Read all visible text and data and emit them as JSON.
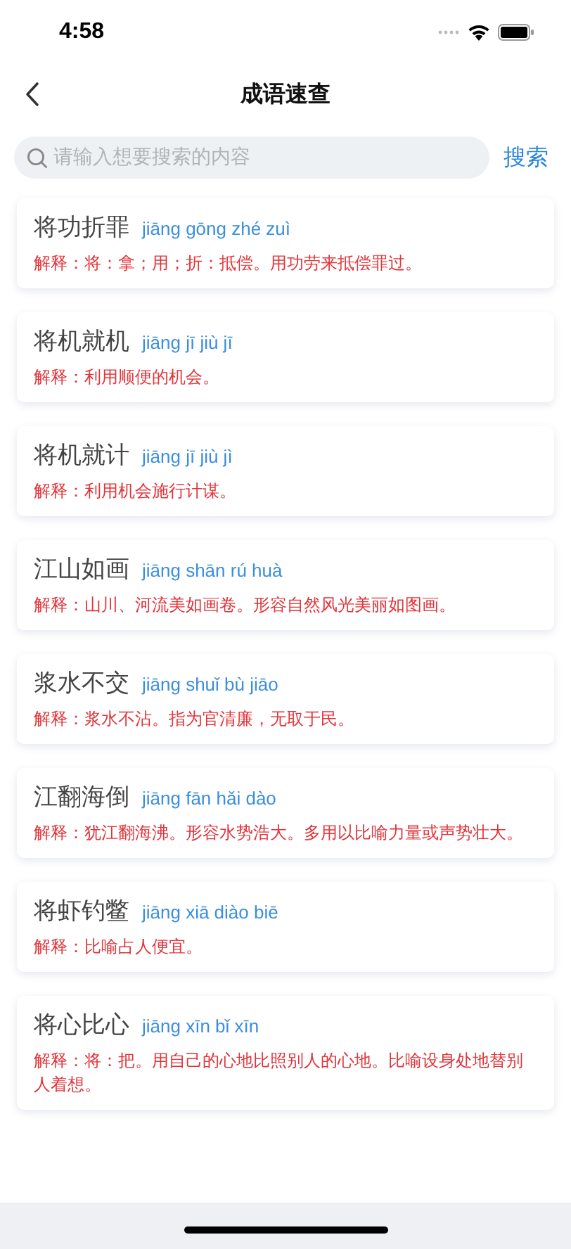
{
  "status_bar": {
    "time": "4:58"
  },
  "nav": {
    "title": "成语速查"
  },
  "search": {
    "placeholder": "请输入想要搜索的内容",
    "button": "搜索"
  },
  "idioms": [
    {
      "word": "将功折罪",
      "pinyin": "jiāng gōng zhé zuì",
      "explanation": "解释：将：拿；用；折：抵偿。用功劳来抵偿罪过。"
    },
    {
      "word": "将机就机",
      "pinyin": "jiāng jī jiù jī",
      "explanation": "解释：利用顺便的机会。"
    },
    {
      "word": "将机就计",
      "pinyin": "jiāng jī jiù jì",
      "explanation": "解释：利用机会施行计谋。"
    },
    {
      "word": "江山如画",
      "pinyin": "jiāng shān rú huà",
      "explanation": "解释：山川、河流美如画卷。形容自然风光美丽如图画。"
    },
    {
      "word": "浆水不交",
      "pinyin": "jiāng shuǐ bù jiāo",
      "explanation": "解释：浆水不沾。指为官清廉，无取于民。"
    },
    {
      "word": "江翻海倒",
      "pinyin": "jiāng fān hǎi dào",
      "explanation": "解释：犹江翻海沸。形容水势浩大。多用以比喻力量或声势壮大。"
    },
    {
      "word": "将虾钓鳖",
      "pinyin": "jiāng xiā diào biē",
      "explanation": "解释：比喻占人便宜。"
    },
    {
      "word": "将心比心",
      "pinyin": "jiāng xīn bǐ xīn",
      "explanation": "解释：将：把。用自己的心地比照别人的心地。比喻设身处地替别人着想。"
    }
  ]
}
